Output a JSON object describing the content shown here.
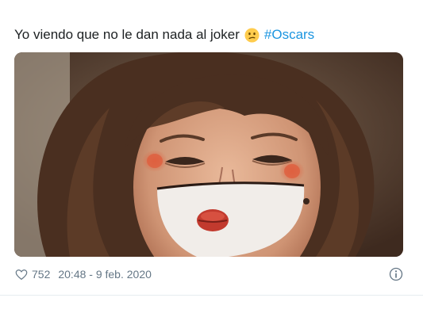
{
  "tweet": {
    "text": "Yo viendo que no le dan nada al joker",
    "emoji": "confused-face-emoji",
    "hashtag": "#Oscars",
    "hashtag_color": "#1b95e0"
  },
  "media": {
    "alt": "clown-makeup-face-photo"
  },
  "footer": {
    "like_icon": "heart-outline-icon",
    "like_count": "752",
    "timestamp": "20:48 - 9 feb. 2020",
    "info_icon": "info-circle-icon"
  }
}
